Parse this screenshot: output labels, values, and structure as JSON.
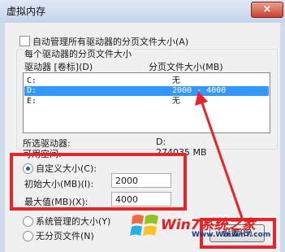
{
  "window": {
    "title": "虚拟内存",
    "close_glyph": "×"
  },
  "auto_manage": {
    "label": "自动管理所有驱动器的分页文件大小(A)",
    "checked": false
  },
  "group": {
    "caption": "每个驱动器的分页文件大小",
    "col_drive": "驱动器 [卷标](D)",
    "col_size": "分页文件大小(MB)"
  },
  "drives": [
    {
      "drive": "C:",
      "size": "无"
    },
    {
      "drive": "D:",
      "size": "2000 - 4000"
    },
    {
      "drive": "E:",
      "size": "无"
    }
  ],
  "selected": {
    "drive_label": "所选驱动器:",
    "drive_value": "D:",
    "space_label": "可用空间:",
    "space_value": "274035 MB"
  },
  "options": {
    "custom_label": "自定义大小(C):",
    "initial_label": "初始大小(MB)(I):",
    "initial_value": "2000",
    "max_label": "最大值(MB)(X):",
    "max_value": "4000",
    "system_label": "系统管理的大小(Y)",
    "none_label": "无分页文件(N)"
  },
  "buttons": {
    "set_label": "设置(S)"
  },
  "watermark": {
    "brand": "Win7系统之家",
    "url": "Www.Winwin7.com"
  },
  "colors": {
    "annotation": "#e8242a",
    "selection": "#3399ff"
  }
}
